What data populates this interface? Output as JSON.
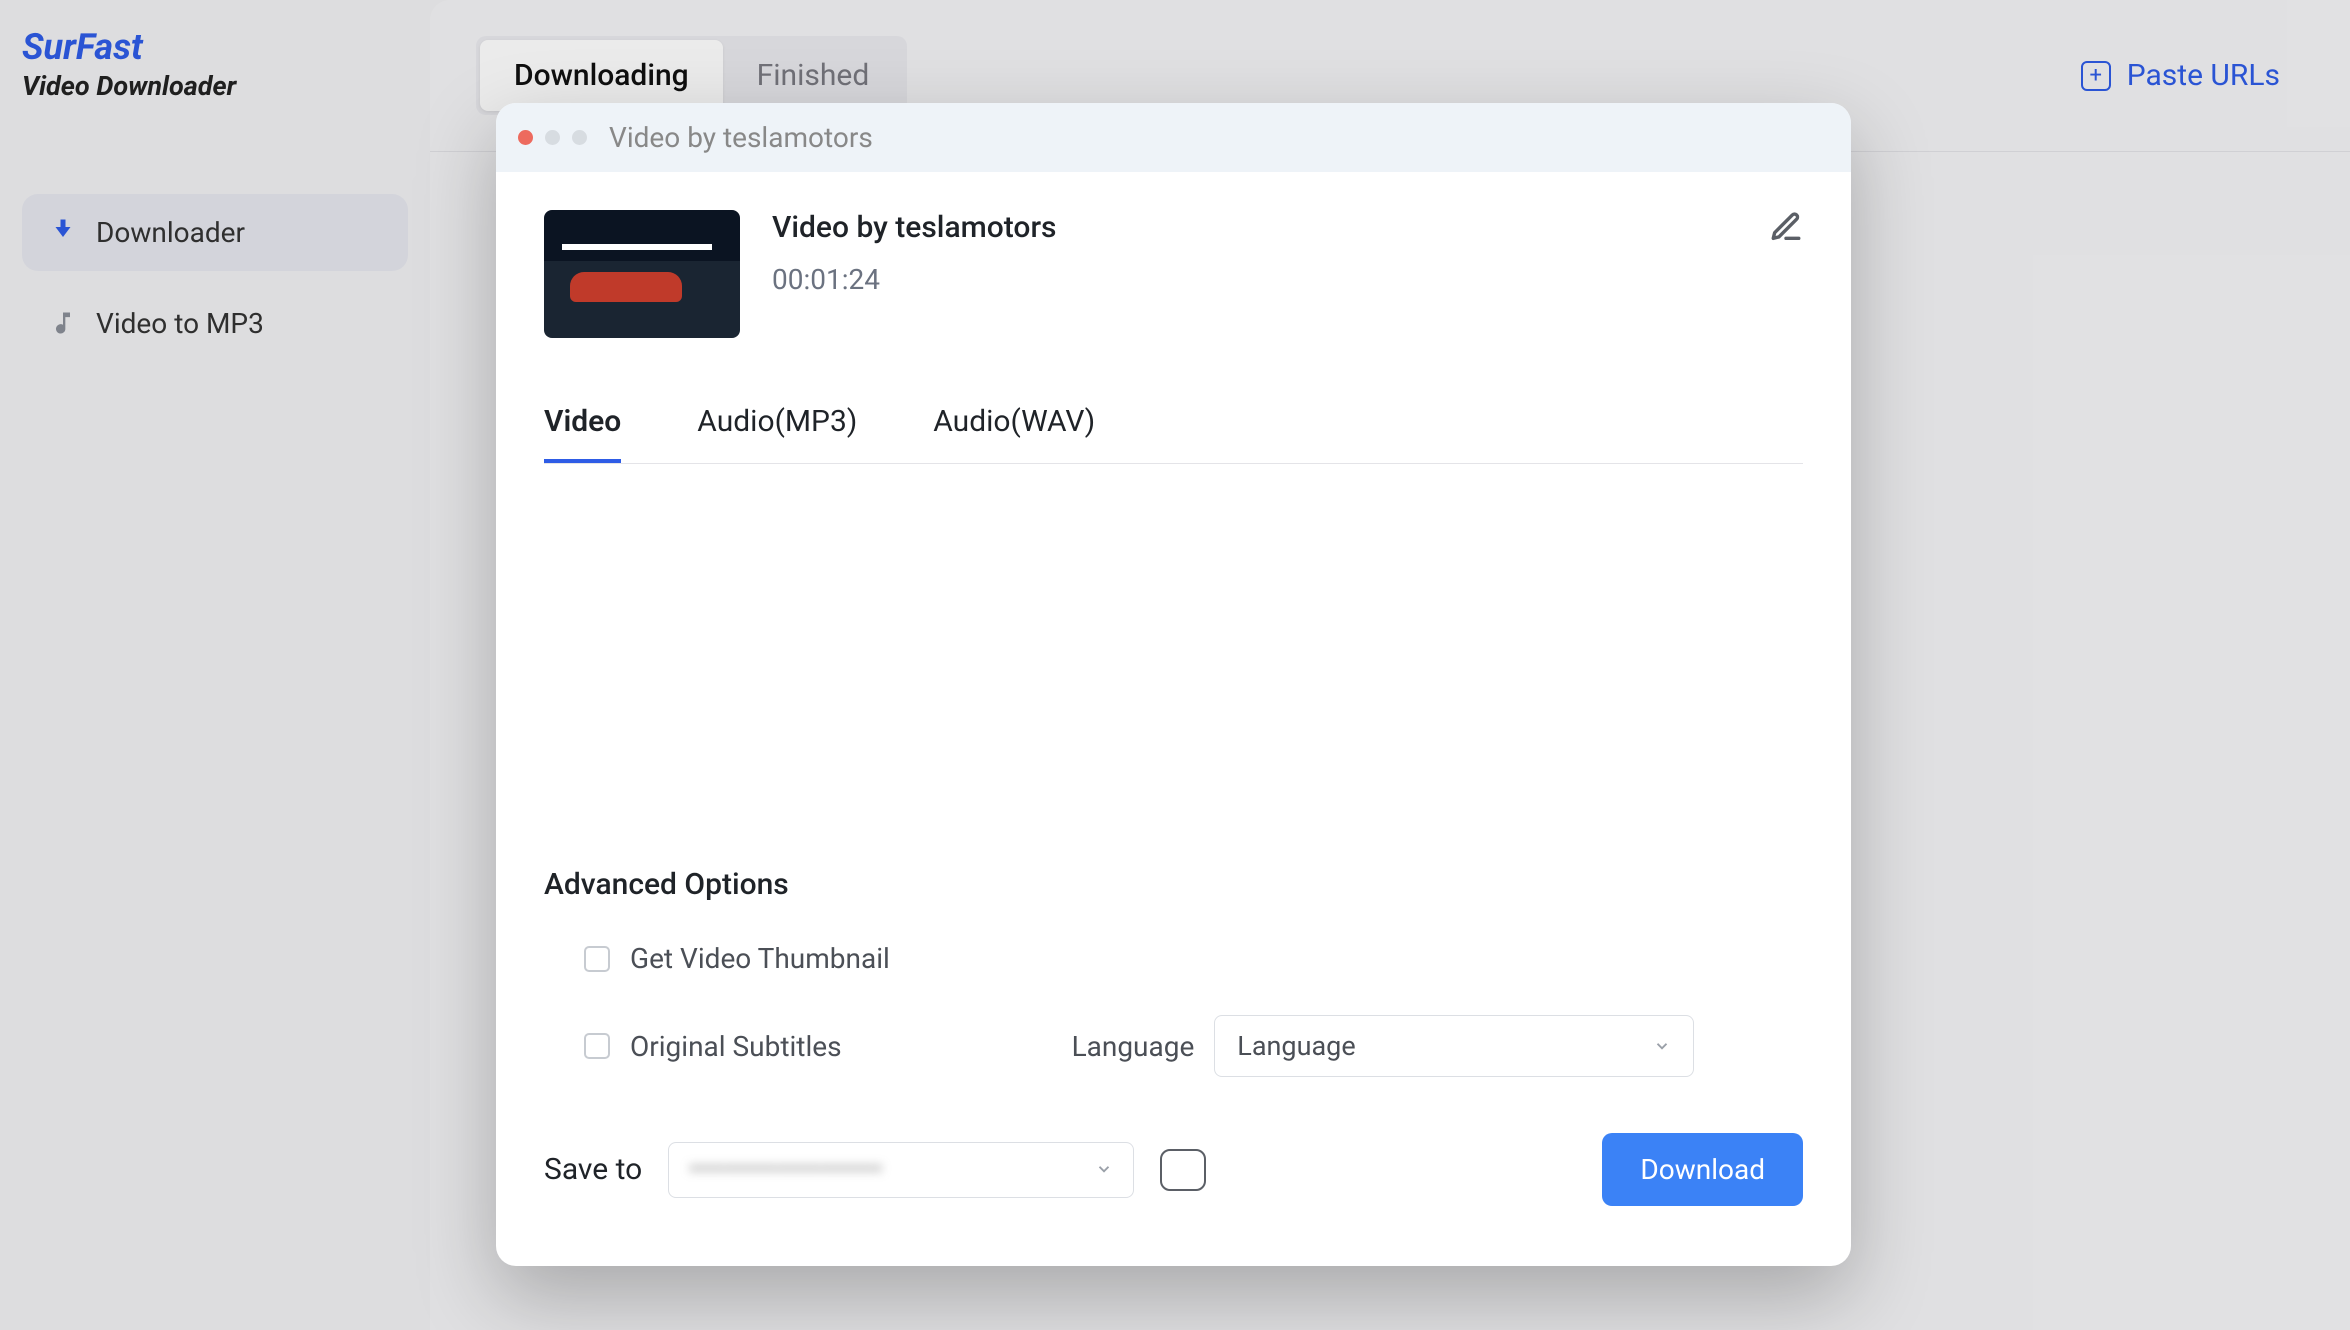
{
  "brand": {
    "name": "SurFast",
    "sub": "Video Downloader"
  },
  "sidebar": {
    "items": [
      {
        "label": "Downloader"
      },
      {
        "label": "Video to MP3"
      }
    ]
  },
  "header": {
    "tabs": [
      {
        "label": "Downloading"
      },
      {
        "label": "Finished"
      }
    ],
    "paste": "Paste URLs"
  },
  "modal": {
    "title": "Video by teslamotors",
    "video": {
      "title": "Video by teslamotors",
      "duration": "00:01:24"
    },
    "formats": [
      {
        "label": "Video"
      },
      {
        "label": "Audio(MP3)"
      },
      {
        "label": "Audio(WAV)"
      }
    ],
    "advanced": {
      "title": "Advanced Options",
      "thumb": "Get Video Thumbnail",
      "subs": "Original Subtitles",
      "lang_label": "Language",
      "lang_value": "Language"
    },
    "footer": {
      "save_to": "Save to",
      "path": "••••••••••••••••••••••",
      "download": "Download"
    }
  }
}
